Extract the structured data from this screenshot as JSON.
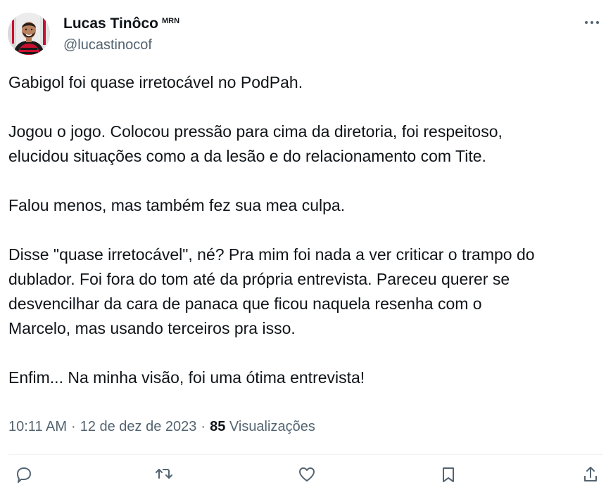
{
  "author": {
    "display_name": "Lucas Tinôco",
    "tag": "MRN",
    "handle": "@lucastinocof",
    "avatar_icon": "profile-photo"
  },
  "more_icon": "more-options-icon",
  "tweet": {
    "paragraphs": [
      "Gabigol foi quase irretocável no PodPah.",
      "Jogou o jogo. Colocou pressão para cima da diretoria, foi respeitoso,\nelucidou situações como a da lesão e do relacionamento com Tite.",
      "Falou menos, mas também fez sua mea culpa.",
      "Disse \"quase irretocável\", né? Pra mim foi nada a ver criticar o trampo do\ndublador. Foi fora do tom até da própria entrevista. Pareceu querer se\ndesvencilhar da cara de panaca que ficou naquela resenha com o\nMarcelo, mas usando terceiros pra isso.",
      "Enfim... Na minha visão, foi uma ótima entrevista!"
    ]
  },
  "meta": {
    "time": "10:11 AM",
    "separator": "·",
    "date": "12 de dez de 2023",
    "views_count": "85",
    "views_label": "Visualizações"
  },
  "actions": [
    "reply-icon",
    "retweet-icon",
    "like-icon",
    "bookmark-icon",
    "share-icon"
  ],
  "colors": {
    "text": "#0f1419",
    "secondary": "#536471",
    "divider": "#eff3f4",
    "jersey_red": "#c8102e"
  }
}
